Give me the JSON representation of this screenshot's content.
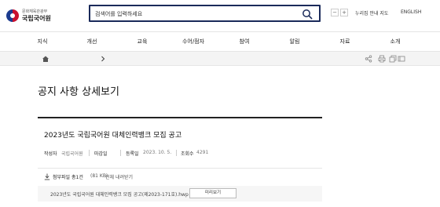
{
  "header": {
    "logo_sub": "문화체육관광부",
    "logo_main": "국립국어원",
    "search_placeholder": "검색어를 입력하세요",
    "zoom_out": "−",
    "zoom_in": "+",
    "sitemap_label": "누리집 안내 지도",
    "english_label": "ENGLISH"
  },
  "nav": {
    "items": [
      "지식",
      "개선",
      "교육",
      "수어/점자",
      "참여",
      "알림",
      "자료",
      "소개"
    ]
  },
  "page": {
    "title": "공지 사항 상세보기"
  },
  "post": {
    "title": "2023년도 국립국어원 대체인력뱅크 모집 공고",
    "author_label": "작성자",
    "author": "국립국어원",
    "deadline_label": "마감일",
    "deadline": "",
    "date_label": "등록일",
    "date": "2023. 10. 5.",
    "views_label": "조회수",
    "views": "4291"
  },
  "attachments": {
    "count_label": "첨부파일 총1건",
    "size": "(81 KB)",
    "download_all": "전체 내려받기",
    "files": [
      {
        "name": "2023년도 국립국어원 대체인력뱅크 모집 공고(제2023-171호).hwp",
        "preview_label": "미리보기"
      }
    ]
  },
  "icons": [
    "home-icon",
    "chevron-right-icon",
    "share-icon",
    "print-icon",
    "copy-icon",
    "bookmark-icon",
    "search-icon",
    "download-icon"
  ],
  "colors": {
    "search_border": "#1a2a5a",
    "emblem_red": "#c8102e",
    "emblem_blue": "#1b3b8f"
  }
}
